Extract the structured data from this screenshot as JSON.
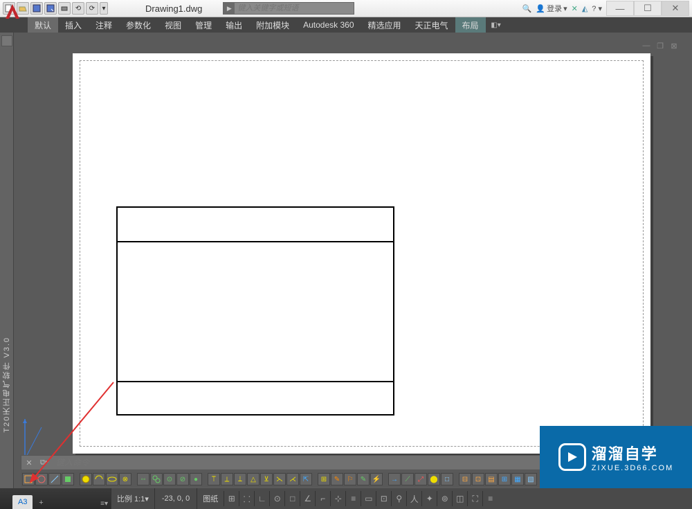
{
  "app": {
    "title": "Drawing1.dwg",
    "search_placeholder": "键入关键字或短语",
    "login": "登录",
    "vertical_panel": "T20天正电气软件 V3.0"
  },
  "ribbon": {
    "tabs": [
      "默认",
      "插入",
      "注释",
      "参数化",
      "视图",
      "管理",
      "输出",
      "附加模块",
      "Autodesk 360",
      "精选应用",
      "天正电气",
      "布局"
    ],
    "active_index": 0,
    "highlighted_index": 11
  },
  "command": {
    "placeholder": "键入命令"
  },
  "status": {
    "layout_tab": "A3",
    "scale_label": "比例 1:1",
    "coords": "-23, 0, 0",
    "paper_label": "图纸"
  },
  "watermark": {
    "cn": "溜溜自学",
    "url": "ZIXUE.3D66.COM"
  },
  "qat_icons": [
    "new",
    "open",
    "save",
    "saveas",
    "print",
    "undo",
    "redo"
  ],
  "status_icons": [
    "paper",
    "grid",
    "snap",
    "ortho",
    "polar",
    "osnap",
    "3dsnap",
    "otrack",
    "ducs",
    "dyn",
    "lwt",
    "tpy",
    "qkp",
    "sc",
    "ann",
    "ws",
    "hw",
    "iso",
    "gs",
    "cln"
  ]
}
